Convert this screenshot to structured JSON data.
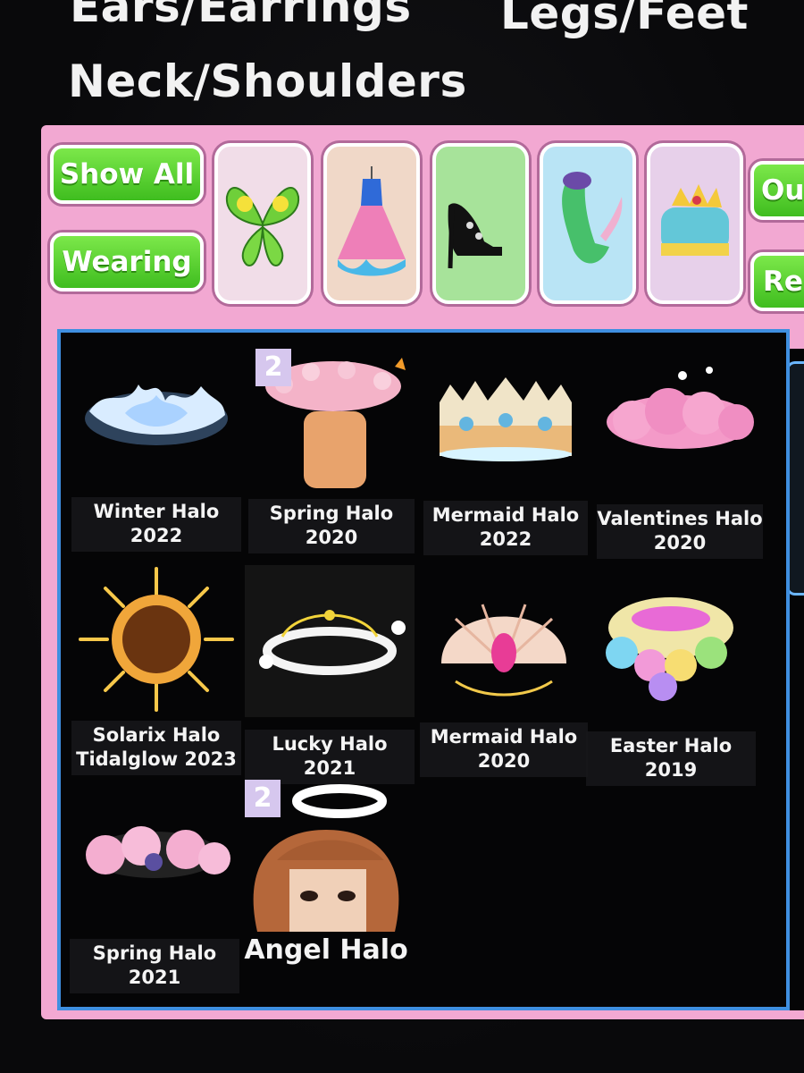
{
  "categories": {
    "ears": "Ears/Earrings",
    "legs": "Legs/Feet",
    "neck": "Neck/Shoulders"
  },
  "filters": {
    "show_all": "Show All",
    "wearing": "Wearing",
    "right_1": "Ou",
    "right_2": "Re",
    "tiles": [
      {
        "icon": "wings-icon"
      },
      {
        "icon": "dress-icon"
      },
      {
        "icon": "heels-icon"
      },
      {
        "icon": "mermaid-tail-icon"
      },
      {
        "icon": "crown-hair-icon"
      }
    ]
  },
  "items": [
    {
      "label_1": "Winter Halo",
      "label_2": "2022",
      "icon": "winter-halo-icon"
    },
    {
      "label_1": "Spring Halo",
      "label_2": "2020",
      "icon": "spring-halo-2020-icon",
      "count": "2"
    },
    {
      "label_1": "Mermaid Halo",
      "label_2": "2022",
      "icon": "mermaid-halo-2022-icon"
    },
    {
      "label_1": "Valentines Halo",
      "label_2": "2020",
      "icon": "valentines-halo-icon"
    },
    {
      "label_1": "Solarix Halo",
      "label_2": "Tidalglow 2023",
      "icon": "solarix-halo-icon"
    },
    {
      "label_1": "Lucky Halo 2021",
      "label_2": "",
      "icon": "lucky-halo-icon"
    },
    {
      "label_1": "Mermaid Halo",
      "label_2": "2020",
      "icon": "mermaid-halo-2020-icon"
    },
    {
      "label_1": "Easter Halo 2019",
      "label_2": "",
      "icon": "easter-halo-icon"
    },
    {
      "label_1": "Spring Halo 2021",
      "label_2": "",
      "icon": "spring-halo-2021-icon"
    },
    {
      "label_1": "Angel Halo",
      "label_2": "",
      "icon": "angel-halo-icon",
      "count": "2"
    }
  ],
  "colors": {
    "accent_green": "#3fbd1f",
    "panel_pink": "#f2a8d2",
    "grid_border": "#3f8fe0"
  }
}
